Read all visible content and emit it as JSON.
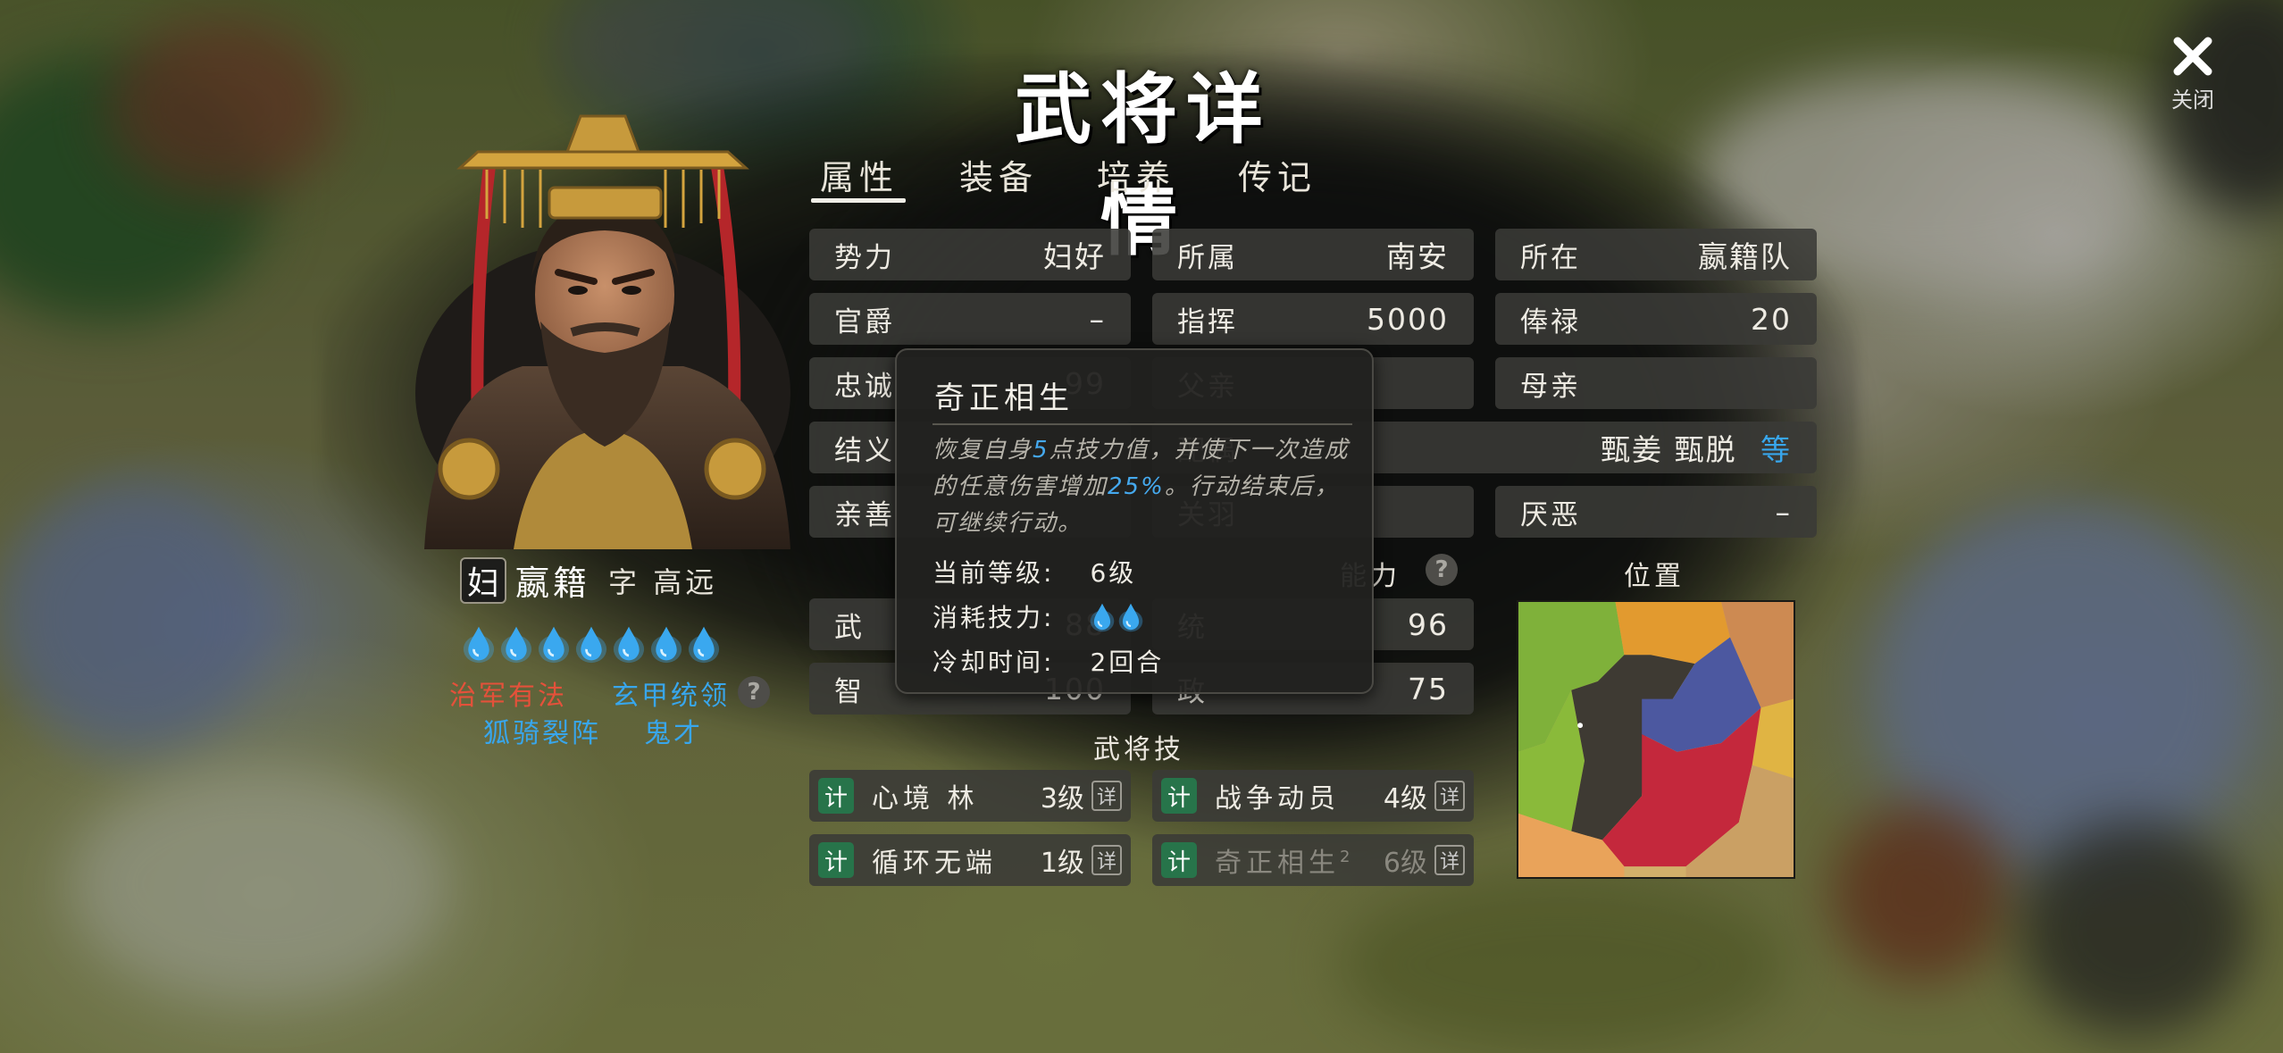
{
  "title": "武将详情",
  "close": {
    "label": "关闭"
  },
  "tabs": [
    "属性",
    "装备",
    "培养",
    "传记"
  ],
  "hero": {
    "faction_badge": "妇",
    "name": "嬴籍",
    "zi": "字 高远",
    "traits": [
      {
        "text": "治军有法",
        "color": "#e4513a"
      },
      {
        "text": "玄甲统领",
        "color": "#38a6ec"
      },
      {
        "text": "狐骑裂阵",
        "color": "#38a6ec"
      },
      {
        "text": "鬼才",
        "color": "#38a6ec"
      }
    ],
    "skill_drops": 7
  },
  "info": {
    "shili": {
      "label": "势力",
      "value": "妇好"
    },
    "suoshu": {
      "label": "所属",
      "value": "南安"
    },
    "suozai": {
      "label": "所在",
      "value": "嬴籍队"
    },
    "guanjue": {
      "label": "官爵",
      "value": "–"
    },
    "zhihui": {
      "label": "指挥",
      "value": "5000"
    },
    "fenglu": {
      "label": "俸禄",
      "value": "20"
    },
    "zhongcheng": {
      "label": "忠诚",
      "value": "99"
    },
    "fuqin": {
      "label": "父亲",
      "value": ""
    },
    "muqin": {
      "label": "母亲",
      "value": ""
    },
    "jieyi": {
      "label": "结义",
      "value": ""
    },
    "peiou": {
      "label": "配偶",
      "value": "甄姜 甄脱",
      "more": "等"
    },
    "qinshan": {
      "label": "亲善",
      "value": ""
    },
    "guanxi": {
      "label": "关羽",
      "value": ""
    },
    "yane": {
      "label": "厌恶",
      "value": "–"
    }
  },
  "stats_section": {
    "label": "能力"
  },
  "stats": [
    {
      "label": "武",
      "value": "88"
    },
    {
      "label": "统",
      "value": "96"
    },
    {
      "label": "智",
      "value": "100"
    },
    {
      "label": "政",
      "value": "75"
    }
  ],
  "position": {
    "label": "位置"
  },
  "skills_section": {
    "label": "武将技"
  },
  "skills": [
    {
      "tag": "计",
      "name": "心境 林",
      "level": "3级",
      "detail": "详"
    },
    {
      "tag": "计",
      "name": "战争动员",
      "level": "4级",
      "detail": "详"
    },
    {
      "tag": "计",
      "name": "循环无端",
      "level": "1级",
      "detail": "详"
    },
    {
      "tag": "计",
      "name": "奇正相生",
      "sup": "2",
      "level": "6级",
      "detail": "详"
    }
  ],
  "tooltip": {
    "title": "奇正相生",
    "desc_1": "恢复自身",
    "desc_hl_1": "5",
    "desc_2": "点技力值，并使下一次造成的任意伤害增加",
    "desc_hl_2": "25%",
    "desc_3": "。行动结束后，可继续行动。",
    "level_label": "当前等级:",
    "level_value": "6级",
    "cost_label": "消耗技力:",
    "cost_drops": 2,
    "cooldown_label": "冷却时间:",
    "cooldown_value": "2回合"
  },
  "colors": {
    "accent_blue": "#38a6ec",
    "accent_red": "#e4513a",
    "skill_green": "#27744a"
  }
}
